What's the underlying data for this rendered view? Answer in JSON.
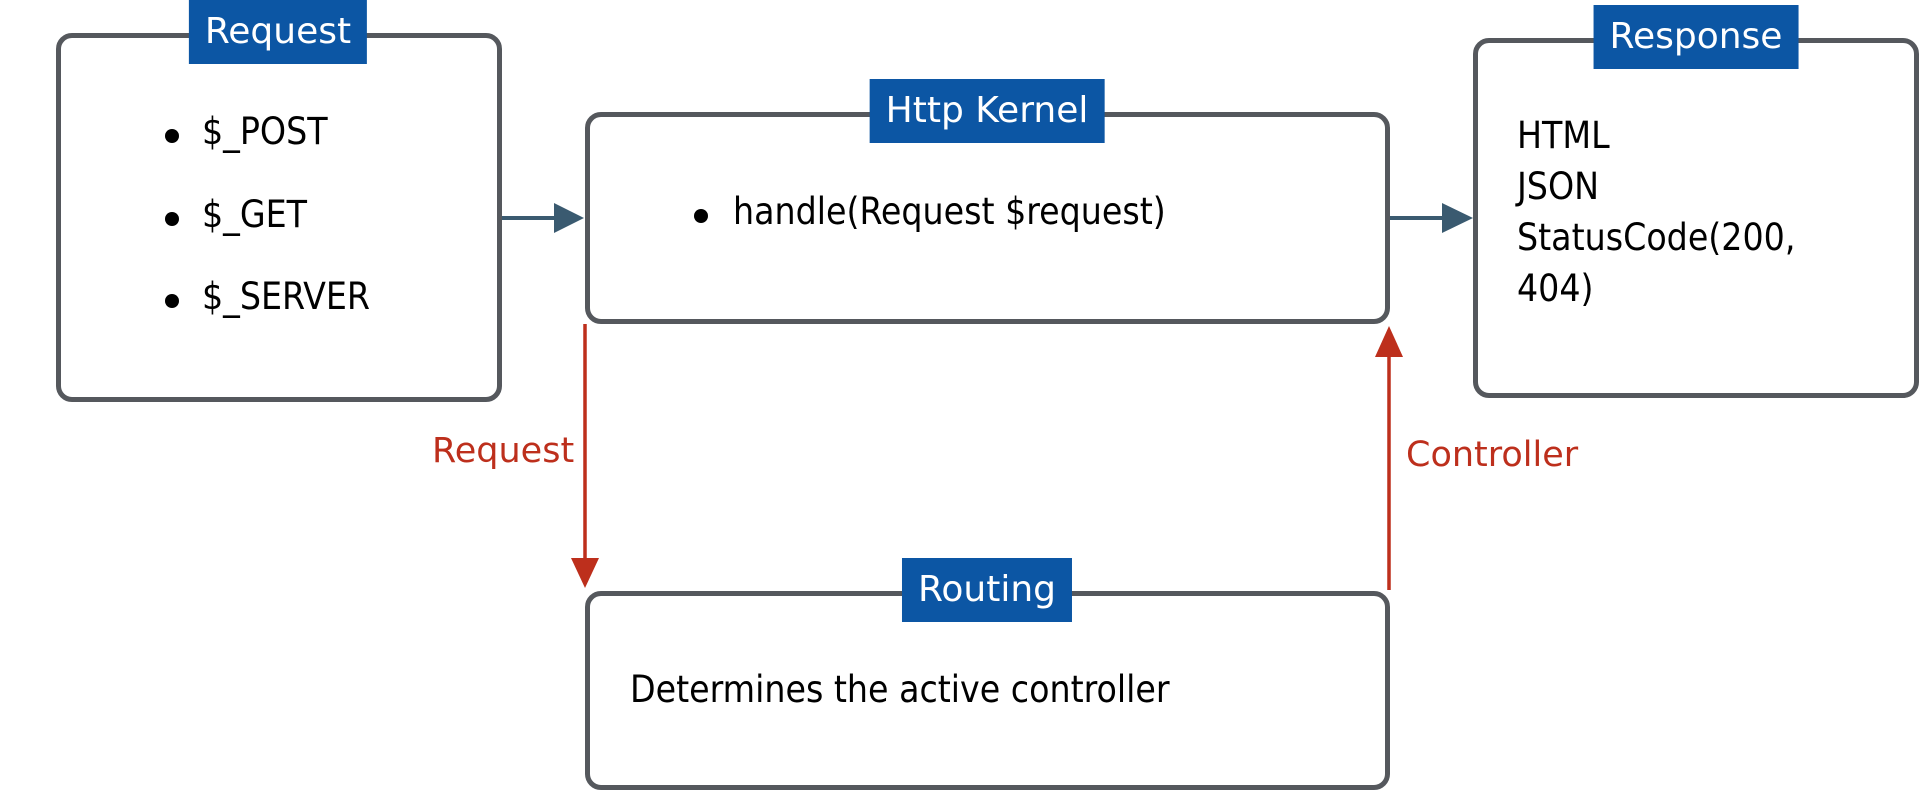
{
  "diagram": {
    "colors": {
      "box_border": "#55585d",
      "title_bg": "#0c56a4",
      "title_text": "#ffffff",
      "flow_arrow": "#3a5a70",
      "routing_arrow": "#bd2f1c"
    },
    "nodes": {
      "request": {
        "title": "Request",
        "items": [
          "$_POST",
          "$_GET",
          "$_SERVER"
        ]
      },
      "http_kernel": {
        "title": "Http Kernel",
        "items": [
          "handle(Request $request)"
        ]
      },
      "response": {
        "title": "Response",
        "lines": [
          "HTML",
          "JSON",
          "StatusCode(200,",
          "404)"
        ]
      },
      "routing": {
        "title": "Routing",
        "text": "Determines the active controller"
      }
    },
    "edges": [
      {
        "from": "request",
        "to": "http_kernel",
        "label": ""
      },
      {
        "from": "http_kernel",
        "to": "response",
        "label": ""
      },
      {
        "from": "http_kernel",
        "to": "routing",
        "label": "Request"
      },
      {
        "from": "routing",
        "to": "http_kernel",
        "label": "Controller"
      }
    ]
  }
}
